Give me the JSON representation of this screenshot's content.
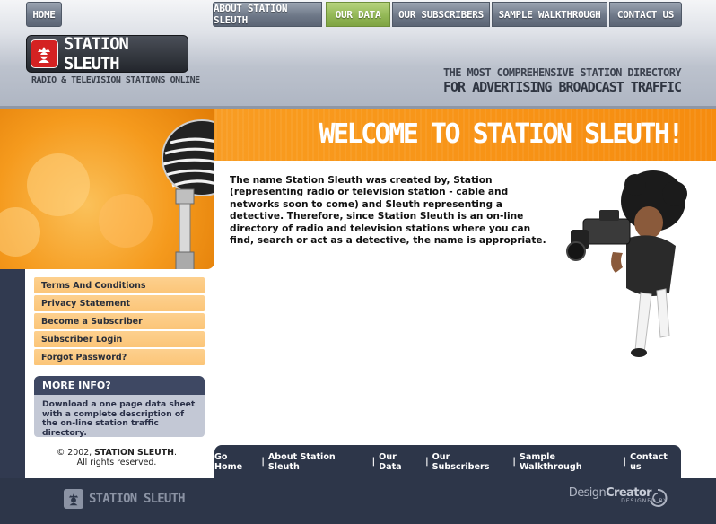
{
  "nav": {
    "home": "HOME",
    "items": [
      "ABOUT STATION SLEUTH",
      "OUR DATA",
      "OUR SUBSCRIBERS",
      "SAMPLE WALKTHROUGH",
      "CONTACT US"
    ],
    "active_index": 1
  },
  "logo": {
    "name": "STATION SLEUTH",
    "subtitle": "RADIO & TELEVISION STATIONS ONLINE"
  },
  "tagline": {
    "line1": "THE MOST COMPREHENSIVE STATION DIRECTORY",
    "line2": "FOR ADVERTISING BROADCAST TRAFFIC"
  },
  "banner": {
    "title": "WELCOME TO STATION SLEUTH!"
  },
  "intro": {
    "text": "The name Station Sleuth was created by, Station (representing radio or television station - cable and networks soon to come) and Sleuth representing a detective.  Therefore, since Station Sleuth is an on-line directory of radio and television stations where you can find, search or act as a detective, the name is appropriate."
  },
  "sidebar": {
    "links": [
      "Terms And Conditions",
      "Privacy Statement",
      "Become a Subscriber",
      "Subscriber  Login",
      "Forgot Password?"
    ],
    "more_info_title": "MORE INFO?",
    "more_info_text": "Download a one page data sheet with a complete description of the on-line station traffic directory."
  },
  "copyright": {
    "prefix": "© 2002, ",
    "brand": "STATION SLEUTH",
    "suffix": ".",
    "line2": "All rights reserved."
  },
  "footer": {
    "links": [
      "Go Home",
      "About Station Sleuth",
      "Our Data",
      "Our Subscribers",
      "Sample Walkthrough",
      "Contact us"
    ],
    "separator": "|",
    "logo_text": "STATION SLEUTH",
    "designer_name_a": "Design",
    "designer_name_b": "Creator",
    "designer_sub": "DESIGNED BY"
  },
  "colors": {
    "orange": "#f99a1d",
    "navy": "#2d3649",
    "nav_active": "#93b856",
    "sidebar_link": "#fbc578",
    "more_head": "#3e4863",
    "more_body": "#c3c8d5",
    "logo_red": "#d42222"
  },
  "icons": {
    "logo": "detective-icon",
    "microphone": "microphone-image",
    "camera": "cameraman-image"
  }
}
